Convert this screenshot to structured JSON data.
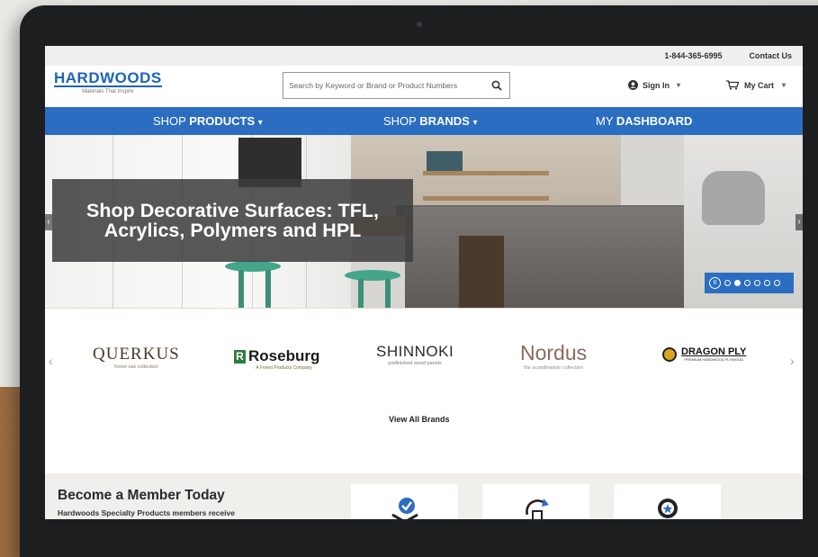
{
  "utility_bar": {
    "phone": "1-844-365-6995",
    "contact": "Contact Us"
  },
  "logo": {
    "name": "HARDWOODS",
    "tagline": "Materials That Inspire"
  },
  "search": {
    "placeholder": "Search by Keyword or Brand or Product Numbers"
  },
  "account": {
    "sign_in": "Sign In",
    "cart": "My Cart"
  },
  "nav": {
    "shop_products_prefix": "SHOP ",
    "shop_products_bold": "PRODUCTS",
    "shop_brands_prefix": "SHOP ",
    "shop_brands_bold": "BRANDS",
    "my_prefix": "MY ",
    "my_bold": "DASHBOARD"
  },
  "hero": {
    "caption": "Shop Decorative Surfaces: TFL, Acrylics, Polymers and HPL",
    "slides": 6,
    "active_slide": 2
  },
  "brands": {
    "items": [
      {
        "name": "QUERKUS",
        "tag": "forest oak collection"
      },
      {
        "name": "Roseburg",
        "tag": "A Forest Products Company"
      },
      {
        "name": "SHINNOKI",
        "tag": "prefinished wood panels"
      },
      {
        "name": "Nordus",
        "tag": "the scandinavian collection"
      },
      {
        "name": "DRAGON PLY",
        "tag": "PREMIUM HARDWOOD PLYWOOD"
      }
    ],
    "view_all": "View All Brands"
  },
  "member": {
    "title": "Become a Member Today",
    "subtitle": "Hardwoods Specialty Products members receive"
  },
  "colors": {
    "brand_blue": "#2b6dc0",
    "caption_bg": "#3c3c3e",
    "stool_green": "#45a58a"
  }
}
